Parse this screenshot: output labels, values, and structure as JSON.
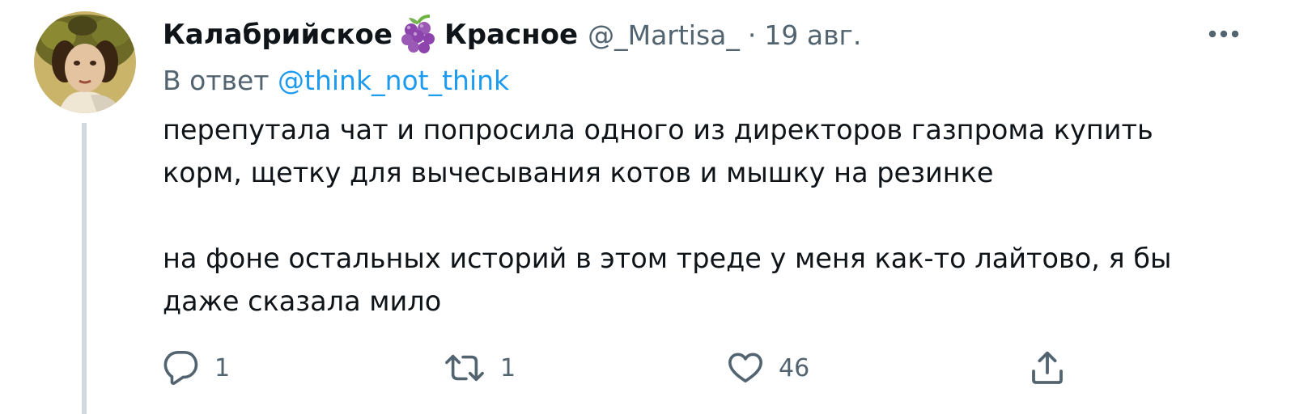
{
  "tweet": {
    "display_name_part1": "Калабрийское",
    "display_name_part2": "Красное",
    "name_emoji": "grapes-icon",
    "handle": "@_Martisa_",
    "separator": "·",
    "date": "19 авг.",
    "reply_prefix": "В ответ",
    "reply_mention": "@think_not_think",
    "text_lines": [
      "перепутала чат и попросила одного из директоров газпрома купить",
      "корм, щетку для вычесывания котов и мышку на резинке",
      "на фоне остальных историй в этом треде у меня как-то лайтово, я бы",
      "даже сказала мило"
    ]
  },
  "actions": {
    "reply": {
      "icon": "reply-icon",
      "count": "1"
    },
    "retweet": {
      "icon": "retweet-icon",
      "count": "1"
    },
    "like": {
      "icon": "heart-icon",
      "count": "46"
    },
    "share": {
      "icon": "share-icon"
    }
  },
  "more_menu": {
    "icon": "more-icon"
  },
  "colors": {
    "text_primary": "#0f1419",
    "text_secondary": "#536471",
    "link": "#1d9bf0",
    "thread_line": "#cfd9de"
  }
}
